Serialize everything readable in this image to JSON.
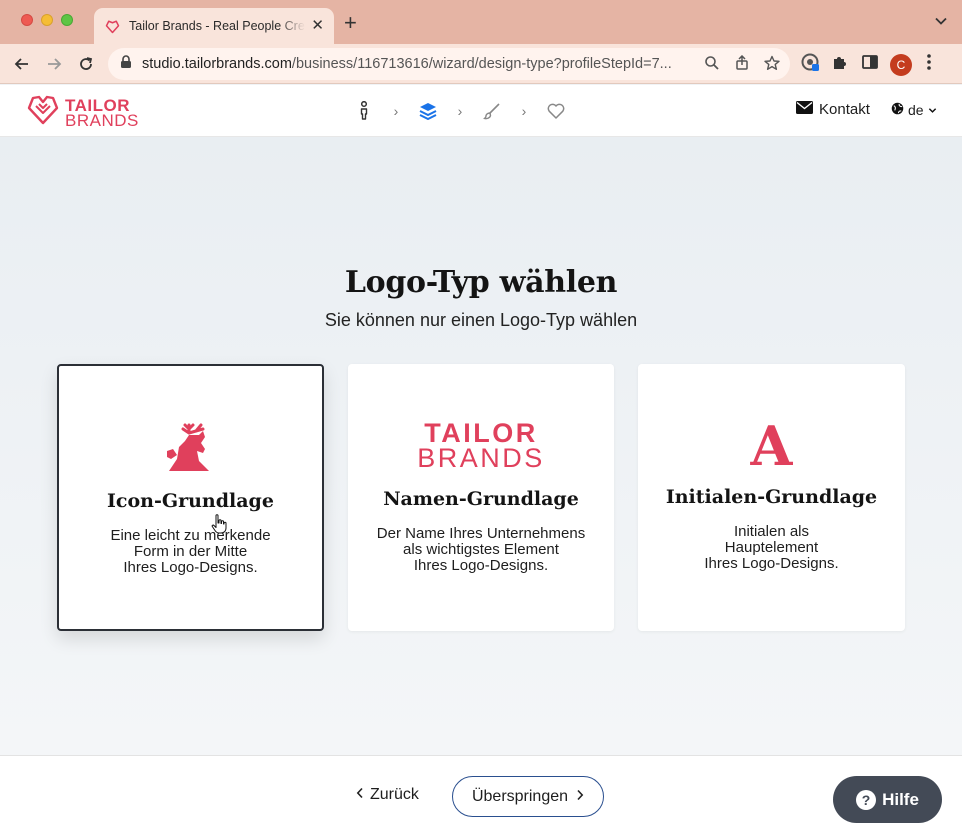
{
  "browser": {
    "tab_title": "Tailor Brands - Real People Cre",
    "new_tab_symbol": "+",
    "close_symbol": "✕",
    "url_host": "studio.tailorbrands.com",
    "url_path": "/business/116713616/wizard/design-type?profileStepId=7...",
    "profile_initial": "C",
    "theme_color": "#e5b4a4"
  },
  "header": {
    "brand_line1": "TAILOR",
    "brand_line2": "BRANDS",
    "brand_color": "#e0405c",
    "steps": [
      "person-icon",
      "layers-icon",
      "brush-icon",
      "heart-icon"
    ],
    "active_step": 1,
    "contact_label": "Kontakt",
    "language": "de"
  },
  "main": {
    "title": "Logo-Typ wählen",
    "subtitle": "Sie können nur einen Logo-Typ wählen",
    "cards": [
      {
        "title": "Icon-Grundlage",
        "desc": [
          "Eine leicht zu merkende",
          "Form in der Mitte",
          "Ihres Logo-Designs."
        ],
        "selected": true,
        "art": "deer-icon"
      },
      {
        "title": "Namen-Grundlage",
        "desc": [
          "Der Name Ihres Unternehmens",
          "als wichtigstes Element",
          "Ihres Logo-Designs."
        ],
        "selected": false,
        "art": "wordmark",
        "wordmark_line1": "TAILOR",
        "wordmark_line2": "BRANDS"
      },
      {
        "title": "Initialen-Grundlage",
        "desc": [
          "Initialen als",
          "Hauptelement",
          "Ihres Logo-Designs."
        ],
        "selected": false,
        "art": "initial-letter",
        "initial": "A"
      }
    ]
  },
  "footer": {
    "back_label": "Zurück",
    "skip_label": "Überspringen",
    "help_label": "Hilfe",
    "help_symbol": "?"
  }
}
